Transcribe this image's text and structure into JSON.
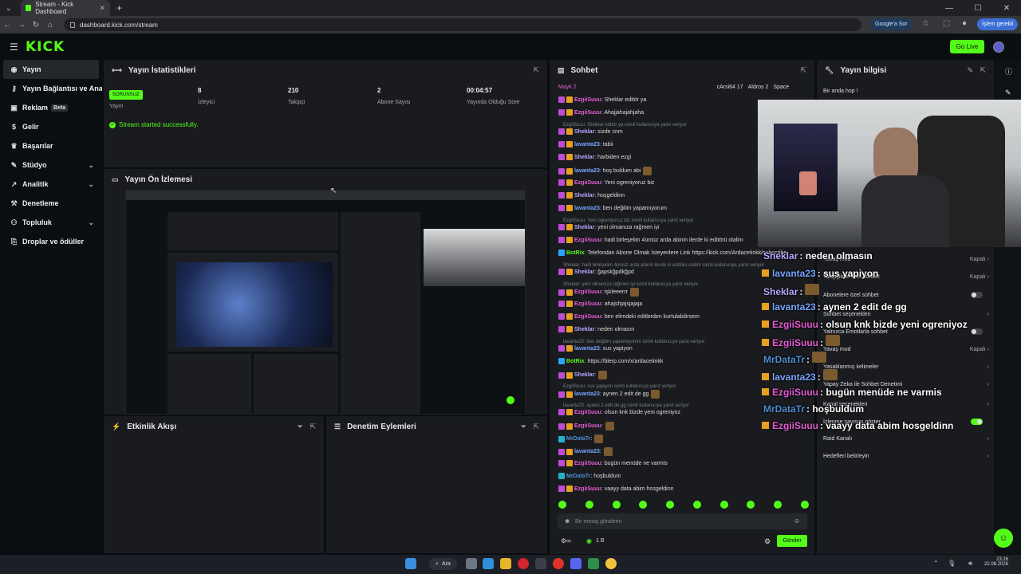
{
  "browser": {
    "tab_title": "Stream - Kick Dashboard",
    "url": "dashboard.kick.com/stream",
    "google_sor": "Google'a Sor",
    "islem_label": "İşlem gerekli"
  },
  "header": {
    "logo": "KICK",
    "go_live": "Go Live"
  },
  "sidebar": {
    "items": [
      {
        "label": "Yayın",
        "icon": "broadcast-icon"
      },
      {
        "label": "Yayın Bağlantısı ve Anahtarı",
        "icon": "key-icon"
      },
      {
        "label": "Reklam",
        "icon": "ad-icon",
        "badge": "Beta"
      },
      {
        "label": "Gelir",
        "icon": "money-icon"
      },
      {
        "label": "Başarılar",
        "icon": "trophy-icon"
      },
      {
        "label": "Stüdyo",
        "icon": "studio-icon"
      },
      {
        "label": "Analitik",
        "icon": "chart-icon"
      },
      {
        "label": "Denetleme",
        "icon": "hammer-icon"
      },
      {
        "label": "Topluluk",
        "icon": "people-icon"
      },
      {
        "label": "Droplar ve ödüller",
        "icon": "gift-icon"
      }
    ]
  },
  "stats_panel": {
    "title": "Yayın İstatistikleri",
    "status_badge": "SORUNSUZ",
    "status_label": "Yayın",
    "viewers": "8",
    "viewers_label": "İzleyici",
    "followers": "210",
    "followers_label": "Takipçi",
    "subs": "2",
    "subs_label": "Abone Sayısı",
    "uptime": "00:04:57",
    "uptime_label": "Yayında Olduğu Süre",
    "success_msg": "Stream started successfully."
  },
  "preview_panel": {
    "title": "Yayın Ön İzlemesi"
  },
  "activity_panel": {
    "title": "Etkinlik Akışı"
  },
  "moderation_panel": {
    "title": "Denetim Eylemleri"
  },
  "chat": {
    "title": "Sohbet",
    "top_users": [
      {
        "name": "Mayk",
        "count": "2"
      },
      {
        "name": "cArsi64",
        "count": "17"
      },
      {
        "name": "Aldros",
        "count": "2"
      },
      {
        "name": "Space",
        "count": ""
      }
    ],
    "messages": [
      {
        "user": "EzgiiSuuu",
        "text": ": Sheklar editör ya",
        "color": "#e55dd4"
      },
      {
        "user": "EzgiiSuuu",
        "text": ": Ahajjahajahjaha",
        "color": "#e55dd4"
      },
      {
        "reply": "EzgiiSuuu: Sheklar editör ya isimli kullanıcıya yanıt veriyor"
      },
      {
        "user": "Sheklar",
        "text": ": sizde cnm",
        "color": "#b9a4ff"
      },
      {
        "user": "lavanta23",
        "text": ": tabii",
        "color": "#7aa5ff"
      },
      {
        "user": "Sheklar",
        "text": ": harbiden ezgi",
        "color": "#b9a4ff"
      },
      {
        "user": "lavanta23",
        "text": ": hoş buldum abi",
        "color": "#7aa5ff"
      },
      {
        "user": "EzgiiSuuu",
        "text": ": Yeni ogreniyoruz biz",
        "color": "#e55dd4"
      },
      {
        "user": "Sheklar",
        "text": ": hoşgeldinn",
        "color": "#b9a4ff"
      },
      {
        "user": "lavanta23",
        "text": ": ben değilim yapamıyorum",
        "color": "#7aa5ff"
      },
      {
        "reply": "EzgiiSuuu: Yeni ogreniyoruz biz isimli kullanıcıya yanıt veriyor"
      },
      {
        "user": "Sheklar",
        "text": ": yeni olmanıza rağmen iyi",
        "color": "#b9a4ff"
      },
      {
        "user": "EzgiiSuuu",
        "text": ": hadi birleşelim 4ümüz arda abinin ilerde ki editörü olalim",
        "color": "#e55dd4"
      },
      {
        "user": "BotRix",
        "text": ": Telefondan Abone Olmak İsteyenlere Link https://kick.com/Ardacetinkk/subscribe",
        "color": "#53fc18"
      },
      {
        "reply": "Sheklar: hadi birleşelim 4ümüz arda abinin ilerde ki editörü olalim isimli kullanıcıya yanıt veriyor"
      },
      {
        "user": "Sheklar",
        "text": ": ğapskğpdkğpd",
        "color": "#b9a4ff"
      },
      {
        "reply": "Sheklar: yeni olmanıza rağmen iyi isimli kullanıcıya yanıt veriyor"
      },
      {
        "user": "EzgiiSuuu",
        "text": ": tşkleeerrr",
        "color": "#e55dd4"
      },
      {
        "user": "EzgiiSuuu",
        "text": ": ahajshjajsjajaja",
        "color": "#e55dd4"
      },
      {
        "user": "EzgiiSuuu",
        "text": ": ben elimdeki editlerden kurtulabilirsem",
        "color": "#e55dd4"
      },
      {
        "user": "Sheklar",
        "text": ": neden olmasın",
        "color": "#b9a4ff"
      },
      {
        "reply": "lavanta23: ben değilim yapamıyorum isimli kullanıcıya yanıt veriyor"
      },
      {
        "user": "lavanta23",
        "text": ": sus yapiyon",
        "color": "#7aa5ff"
      },
      {
        "user": "BotRix",
        "text": ": https://blerp.com/x/ardacetinkk",
        "color": "#53fc18"
      },
      {
        "user": "Sheklar",
        "text": ":",
        "color": "#b9a4ff"
      },
      {
        "reply": "EzgiiSuuu: sus yapiyon isimli kullanıcıya yanıt veriyor"
      },
      {
        "user": "lavanta23",
        "text": ": aynen 2 edit de gg",
        "color": "#7aa5ff"
      },
      {
        "reply": "lavanta23: aynen 2 edit de gg isimli kullanıcıya yanıt veriyor"
      },
      {
        "user": "EzgiiSuuu",
        "text": ": olsun knk bizde yeni ogreniyoz",
        "color": "#e55dd4"
      },
      {
        "user": "EzgiiSuuu",
        "text": ":",
        "color": "#e55dd4"
      },
      {
        "user": "MrDataTr",
        "text": ":",
        "color": "#4f8ccf"
      },
      {
        "user": "lavanta23",
        "text": ":",
        "color": "#7aa5ff"
      },
      {
        "user": "EzgiiSuuu",
        "text": ": bugün menüde ne varmis",
        "color": "#e55dd4"
      },
      {
        "user": "MrDataTr",
        "text": ": hoşbuldum",
        "color": "#4f8ccf"
      },
      {
        "user": "EzgiiSuuu",
        "text": ": vaayy data abim hosgeldinn",
        "color": "#e55dd4"
      }
    ],
    "input_placeholder": "Bir mesaj gönderin",
    "points": "1 B",
    "send_label": "Gönder"
  },
  "stream_info": {
    "title": "Yayın bilgisi",
    "stream_title": "Bir anda hop !"
  },
  "overlay_chat": [
    {
      "user": "Sheklar",
      "text": ": neden olmasın",
      "color": "#b9a4ff"
    },
    {
      "user": "lavanta23",
      "text": ": sus yapiyon",
      "color": "#7aa5ff"
    },
    {
      "user": "Sheklar",
      "text": ":",
      "color": "#b9a4ff"
    },
    {
      "user": "lavanta23",
      "text": ": aynen 2 edit de gg",
      "color": "#7aa5ff"
    },
    {
      "user": "EzgiiSuuu",
      "text": ": olsun knk bizde yeni ogreniyoz",
      "color": "#e55dd4"
    },
    {
      "user": "EzgiiSuuu",
      "text": ":",
      "color": "#e55dd4"
    },
    {
      "user": "MrDataTr",
      "text": ":",
      "color": "#4f8ccf"
    },
    {
      "user": "lavanta23",
      "text": ":",
      "color": "#7aa5ff"
    },
    {
      "user": "EzgiiSuuu",
      "text": ": bugün menüde ne varmis",
      "color": "#e55dd4"
    },
    {
      "user": "MrDataTr",
      "text": ": hoşbuldum",
      "color": "#4f8ccf"
    },
    {
      "user": "EzgiiSuuu",
      "text": ": vaayy data abim hosgeldinn",
      "color": "#e55dd4"
    }
  ],
  "settings": [
    {
      "label": "Yavaş mod",
      "right": "Kapalı"
    },
    {
      "label": "Takipçilere özel sohbet",
      "right": "Kapalı"
    },
    {
      "label": "Abonelere özel sohbet",
      "toggle": false
    },
    {
      "label": "Sohbet seçenekleri",
      "right": ""
    },
    {
      "label": "Yalnızca Emotlarla sohbet",
      "toggle": false
    },
    {
      "label": "Yavaş mod",
      "right": "Kapalı"
    },
    {
      "label": "Yasaklanmış kelimeler",
      "right": ""
    },
    {
      "label": "Yapay Zeka ile Sohbet Denetimi",
      "right": ""
    },
    {
      "label": "Kanal seçenekleri",
      "right": ""
    },
    {
      "label": "İzlenme sayısını göster",
      "toggle": true
    },
    {
      "label": "Raid Kanalı",
      "right": ""
    },
    {
      "label": "Hedefleri belirleyin",
      "right": ""
    }
  ],
  "taskbar": {
    "search": "Ara",
    "time": "23:26",
    "date": "22.08.2026"
  },
  "colors": {
    "accent": "#53fc18",
    "panel": "#191b1f",
    "bg": "#0b0e10"
  }
}
